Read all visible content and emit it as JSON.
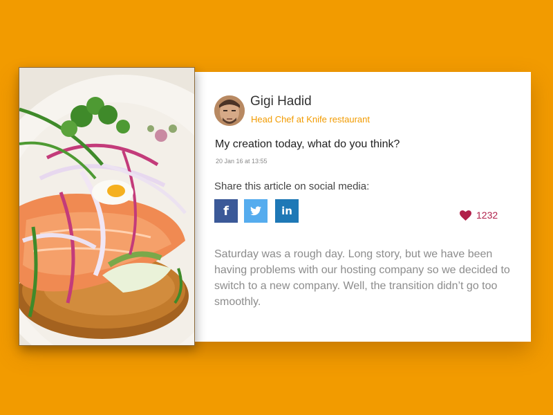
{
  "author": {
    "name": "Gigi Hadid",
    "role": "Head Chef at Knife restaurant"
  },
  "post": {
    "text": "My creation today, what do you think?",
    "timestamp": "20 Jan 16 at 13:55"
  },
  "share": {
    "label": "Share this article on social media:",
    "facebook_label": "f",
    "linkedin_label": "in"
  },
  "likes": {
    "count": "1232"
  },
  "excerpt": "Saturday was a rough day. Long story, but we have been having problems with our hosting company so we decided to switch to a new company. Well, the transition didn’t go too smoothly.",
  "colors": {
    "background": "#F29B00",
    "accent": "#F29B00",
    "like": "#B0204A",
    "facebook": "#3B5998",
    "twitter": "#55ACEE",
    "linkedin": "#1E78B6"
  },
  "icons": {
    "photo": "food-photo",
    "avatar": "avatar",
    "facebook": "facebook-icon",
    "twitter": "twitter-icon",
    "linkedin": "linkedin-icon",
    "like": "heart-icon"
  }
}
